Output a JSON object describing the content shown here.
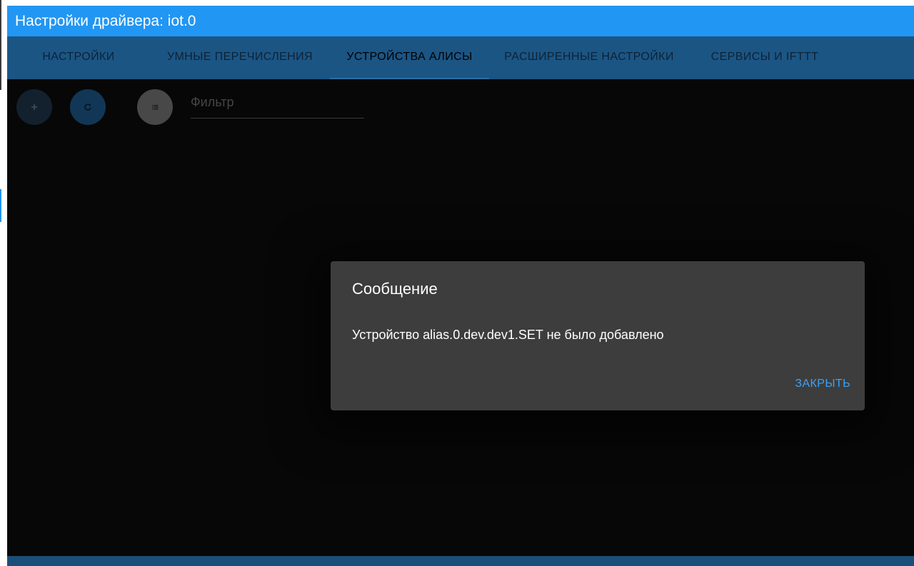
{
  "window": {
    "title": "Настройки драйвера: iot.0"
  },
  "tabs": [
    {
      "label": "НАСТРОЙКИ",
      "active": false
    },
    {
      "label": "УМНЫЕ ПЕРЕЧИСЛЕНИЯ",
      "active": false
    },
    {
      "label": "УСТРОЙСТВА АЛИСЫ",
      "active": true
    },
    {
      "label": "РАСШИРЕННЫЕ НАСТРОЙКИ",
      "active": false
    },
    {
      "label": "СЕРВИСЫ И IFTTT",
      "active": false
    }
  ],
  "toolbar": {
    "add_icon": "plus-icon",
    "refresh_icon": "refresh-icon",
    "list_icon": "list-icon",
    "filter_placeholder": "Фильтр"
  },
  "dialog": {
    "title": "Сообщение",
    "message": "Устройство alias.0.dev.dev1.SET не было добавлено",
    "close_label": "ЗАКРЫТЬ"
  },
  "colors": {
    "titlebar": "#2196f3",
    "tabbar": "#1b5584",
    "background": "#0b0b0b",
    "dialog": "#3d3d3d",
    "accent": "#3fa1f0"
  }
}
